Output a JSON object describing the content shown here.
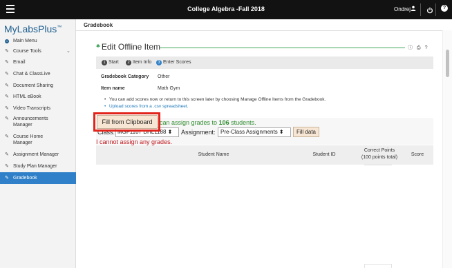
{
  "topbar": {
    "course_title": "College Algebra -Fall 2018",
    "user_name": "Ondrej",
    "icons": [
      "menu-icon",
      "user-icon",
      "power-icon",
      "help-icon"
    ]
  },
  "sidebar": {
    "logo": "MyLabsPlus",
    "logo_mark": "™",
    "items": [
      {
        "label": "Main Menu",
        "icon": "home-icon"
      },
      {
        "label": "Course Tools",
        "icon": "tools-icon",
        "chevron": "⌄"
      },
      {
        "label": "Email",
        "icon": "link-icon"
      },
      {
        "label": "Chat & ClassLive",
        "icon": "link-icon"
      },
      {
        "label": "Document Sharing",
        "icon": "link-icon"
      },
      {
        "label": "HTML eBook",
        "icon": "link-icon"
      },
      {
        "label": "Video Transcripts",
        "icon": "link-icon"
      },
      {
        "label": "Announcements Manager",
        "icon": "link-icon"
      },
      {
        "label": "Course Home Manager",
        "icon": "link-icon"
      },
      {
        "label": "Assignment Manager",
        "icon": "link-icon"
      },
      {
        "label": "Study Plan Manager",
        "icon": "link-icon"
      },
      {
        "label": "Gradebook",
        "icon": "link-icon",
        "active": true
      }
    ]
  },
  "page": {
    "header": "Gradebook",
    "title": "Edit Offline Item",
    "steps": [
      {
        "num": "1",
        "label": "Start"
      },
      {
        "num": "2",
        "label": "Item Info"
      },
      {
        "num": "3",
        "label": "Enter Scores",
        "active": true
      }
    ],
    "fields": [
      {
        "label": "Gradebook Category",
        "value": "Other"
      },
      {
        "label": "Item name",
        "value": "Math Gym"
      }
    ],
    "bullets": [
      "You can add scores now or return to this screen later by choosing Manage Offline Items from the Gradebook.",
      "Upload scores from a .csv spreadsheet."
    ],
    "fill_clipboard_label": "Fill from Clipboard",
    "grade_text_pre": "can assign grades to ",
    "grade_count": "106",
    "grade_text_post": " students.",
    "class_label": "Class:",
    "class_value": "MGF1107 DHL1188",
    "assignment_label": "Assignment:",
    "assignment_value": "Pre-Class Assignments",
    "fill_data_label": "Fill data",
    "error_text": "I cannot assign any grades.",
    "table_headers": {
      "student_name": "Student Name",
      "student_id": "Student ID",
      "correct_points": "Correct Points",
      "points_total": "(100 points total)",
      "score": "Score"
    }
  },
  "colors": {
    "topbar": "#121212",
    "accent": "#2f80c8",
    "title_rule": "#3aa655",
    "highlight": "#e2231a",
    "error": "#c0161c"
  }
}
